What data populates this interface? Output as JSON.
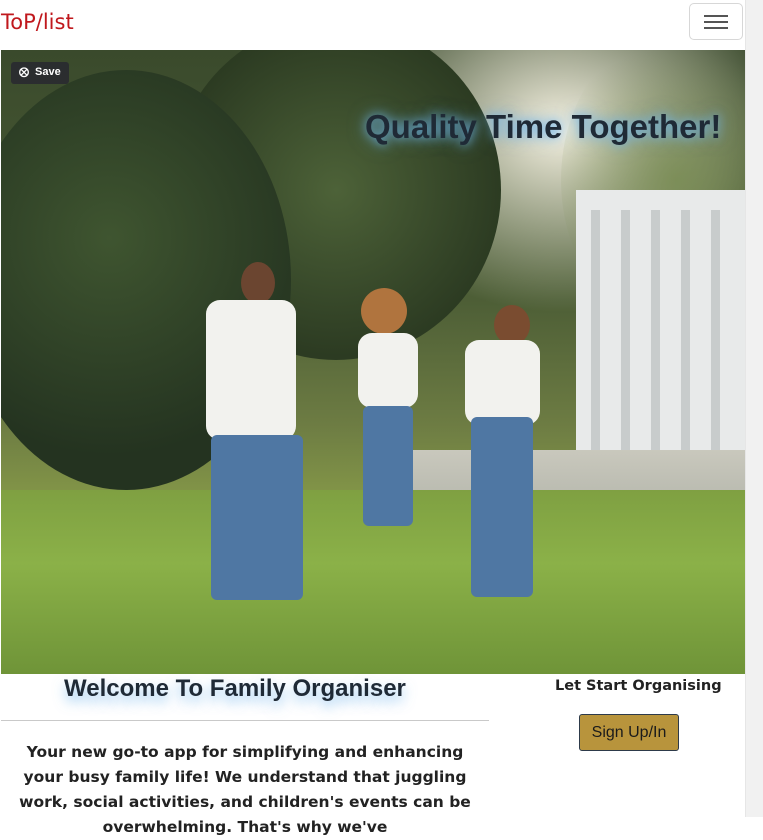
{
  "navbar": {
    "brand": "ToP/list",
    "toggler_icon": "hamburger-menu-icon"
  },
  "hero": {
    "save_icon": "bookmark-icon",
    "save_label": "Save",
    "title": "Quality Time Together!"
  },
  "main": {
    "welcome_title": "Welcome To Family Organiser",
    "description": "Your new go-to app for simplifying and enhancing your busy family life! We understand that juggling work, social activities, and children's events can be overwhelming. That's why we've"
  },
  "aside": {
    "start_text": "Let Start Organising",
    "signup_label": "Sign Up/In"
  },
  "colors": {
    "brand": "#c0181d",
    "signup_button": "#b8943c"
  }
}
